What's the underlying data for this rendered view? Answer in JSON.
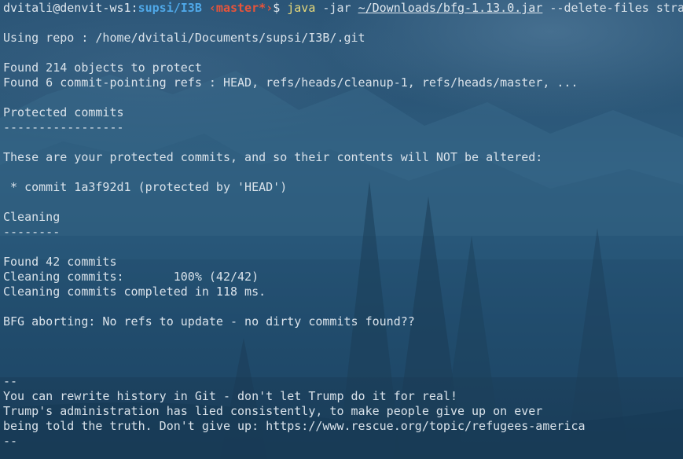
{
  "prompt": {
    "user_host": "dvitali@denvit-ws1:",
    "path": "supsi/I3B",
    "branch": " ‹master*›",
    "symbol": "$ ",
    "command": "java",
    "args_before": " -jar ",
    "jar_path": "~/Downloads/bfg-1.13.0.jar",
    "args_after": " --delete-files stra"
  },
  "output": [
    "",
    "Using repo : /home/dvitali/Documents/supsi/I3B/.git",
    "",
    "Found 214 objects to protect",
    "Found 6 commit-pointing refs : HEAD, refs/heads/cleanup-1, refs/heads/master, ...",
    "",
    "Protected commits",
    "-----------------",
    "",
    "These are your protected commits, and so their contents will NOT be altered:",
    "",
    " * commit 1a3f92d1 (protected by 'HEAD')",
    "",
    "Cleaning",
    "--------",
    "",
    "Found 42 commits",
    "Cleaning commits:       100% (42/42)",
    "Cleaning commits completed in 118 ms.",
    "",
    "BFG aborting: No refs to update - no dirty commits found??",
    "",
    "",
    "",
    "--",
    "You can rewrite history in Git - don't let Trump do it for real!",
    "Trump's administration has lied consistently, to make people give up on ever",
    "being told the truth. Don't give up: https://www.rescue.org/topic/refugees-america",
    "--"
  ],
  "colors": {
    "path": "#4fa8e8",
    "branch": "#e8543a",
    "command": "#e8d97a",
    "text": "#d9e2ea"
  }
}
